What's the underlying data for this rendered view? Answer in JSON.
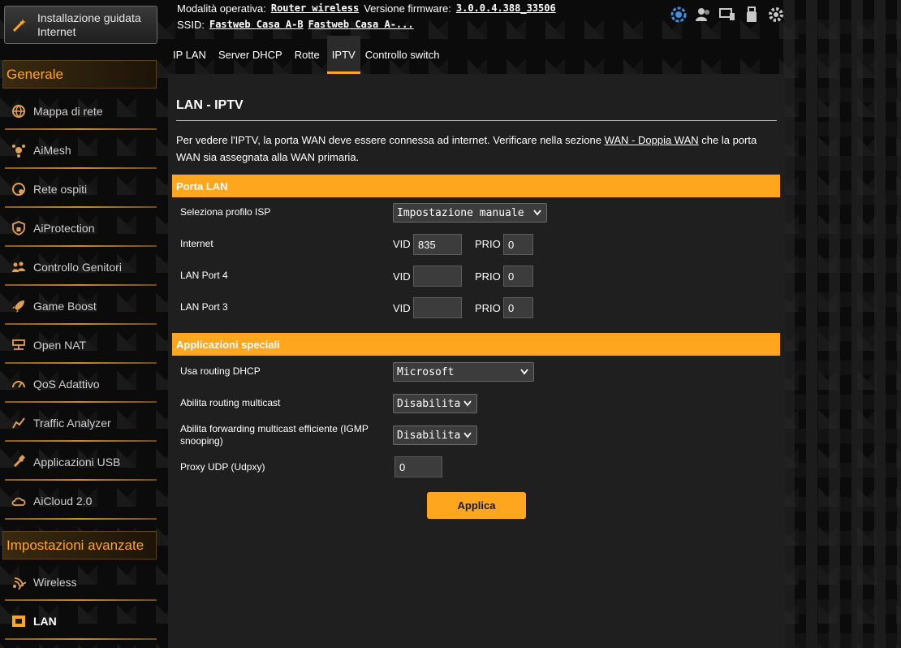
{
  "header": {
    "mode_label": "Modalità operativa:",
    "mode_value": "Router wireless",
    "firmware_label": "Versione firmware:",
    "firmware_value": "3.0.0.4.388_33506",
    "ssid_label": "SSID:",
    "ssid_1": "Fastweb Casa A-B",
    "ssid_2": "Fastweb Casa A-..."
  },
  "top_icons": [
    "network-status-icon",
    "clients-icon",
    "devices-icon",
    "usb-icon",
    "settings-icon"
  ],
  "sidebar": {
    "quick_setup": "Installazione guidata Internet",
    "general_heading": "Generale",
    "general_items": [
      {
        "label": "Mappa di rete",
        "icon": "globe-icon"
      },
      {
        "label": "AiMesh",
        "icon": "mesh-icon"
      },
      {
        "label": "Rete ospiti",
        "icon": "guest-network-icon"
      },
      {
        "label": "AiProtection",
        "icon": "lock-shield-icon"
      },
      {
        "label": "Controllo Genitori",
        "icon": "family-icon"
      },
      {
        "label": "Game Boost",
        "icon": "rocket-icon"
      },
      {
        "label": "Open NAT",
        "icon": "nat-icon"
      },
      {
        "label": "QoS Adattivo",
        "icon": "gauge-icon"
      },
      {
        "label": "Traffic Analyzer",
        "icon": "analyzer-icon"
      },
      {
        "label": "Applicazioni USB",
        "icon": "usb-app-icon"
      },
      {
        "label": "AiCloud 2.0",
        "icon": "cloud-icon"
      }
    ],
    "advanced_heading": "Impostazioni avanzate",
    "advanced_items": [
      {
        "label": "Wireless",
        "icon": "wifi-icon"
      },
      {
        "label": "LAN",
        "icon": "lan-icon"
      }
    ]
  },
  "tabs": [
    {
      "label": "IP LAN",
      "active": false
    },
    {
      "label": "Server DHCP",
      "active": false
    },
    {
      "label": "Rotte",
      "active": false
    },
    {
      "label": "IPTV",
      "active": true
    },
    {
      "label": "Controllo switch",
      "active": false
    }
  ],
  "main": {
    "title": "LAN - IPTV",
    "desc_part1": "Per vedere l'IPTV, la porta WAN deve essere connessa ad internet. Verificare nella sezione ",
    "desc_link": "WAN - Doppia WAN",
    "desc_part2": " che la porta WAN sia assegnata alla WAN primaria.",
    "lan_section": {
      "heading": "Porta LAN",
      "isp_label": "Seleziona profilo ISP",
      "isp_value": "Impostazione manuale",
      "vid_label": "VID",
      "prio_label": "PRIO",
      "rows": [
        {
          "label": "Internet",
          "vid": "835",
          "prio": "0"
        },
        {
          "label": "LAN Port 4",
          "vid": "",
          "prio": "0"
        },
        {
          "label": "LAN Port 3",
          "vid": "",
          "prio": "0"
        }
      ]
    },
    "special_section": {
      "heading": "Applicazioni speciali",
      "dhcp_label": "Usa routing DHCP",
      "dhcp_value": "Microsoft",
      "multicast_label": "Abilita routing multicast",
      "multicast_value": "Disabilita",
      "igmp_label": "Abilita forwarding multicast efficiente (IGMP snooping)",
      "igmp_value": "Disabilita",
      "udpxy_label": "Proxy UDP (Udpxy)",
      "udpxy_value": "0"
    },
    "apply_label": "Applica"
  },
  "colors": {
    "accent": "#ffa61f",
    "panel": "#1f1f1f",
    "active_icon": "#3d8fe0"
  }
}
